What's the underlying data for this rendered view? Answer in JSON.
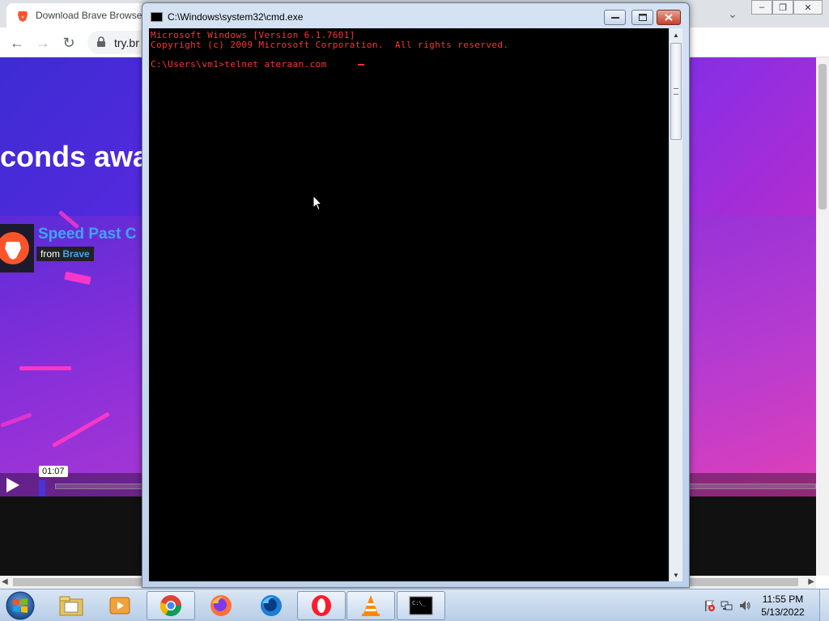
{
  "browser": {
    "tab_title": "Download Brave Browser",
    "address": "try.br",
    "hero_text": "conds awa",
    "video": {
      "title": "Speed Past C",
      "from_label": "from",
      "from_name": "Brave",
      "time": "01:07"
    }
  },
  "cmd": {
    "title": "C:\\Windows\\system32\\cmd.exe",
    "lines": [
      "Microsoft Windows [Version 6.1.7601]",
      "Copyright (c) 2009 Microsoft Corporation.  All rights reserved.",
      "",
      "C:\\Users\\vm1>telnet ateraan.com "
    ],
    "text_color": "#ff3333"
  },
  "taskbar": {
    "items": [
      {
        "name": "explorer-taskbar-icon"
      },
      {
        "name": "media-player-taskbar-icon"
      },
      {
        "name": "chrome-taskbar-icon"
      },
      {
        "name": "firefox-taskbar-icon"
      },
      {
        "name": "firefox-dev-taskbar-icon"
      },
      {
        "name": "opera-taskbar-icon"
      },
      {
        "name": "vlc-taskbar-icon"
      },
      {
        "name": "cmd-taskbar-icon"
      }
    ],
    "cmd_icon_text": "C:\\_",
    "clock_time": "11:55 PM",
    "clock_date": "5/13/2022"
  }
}
